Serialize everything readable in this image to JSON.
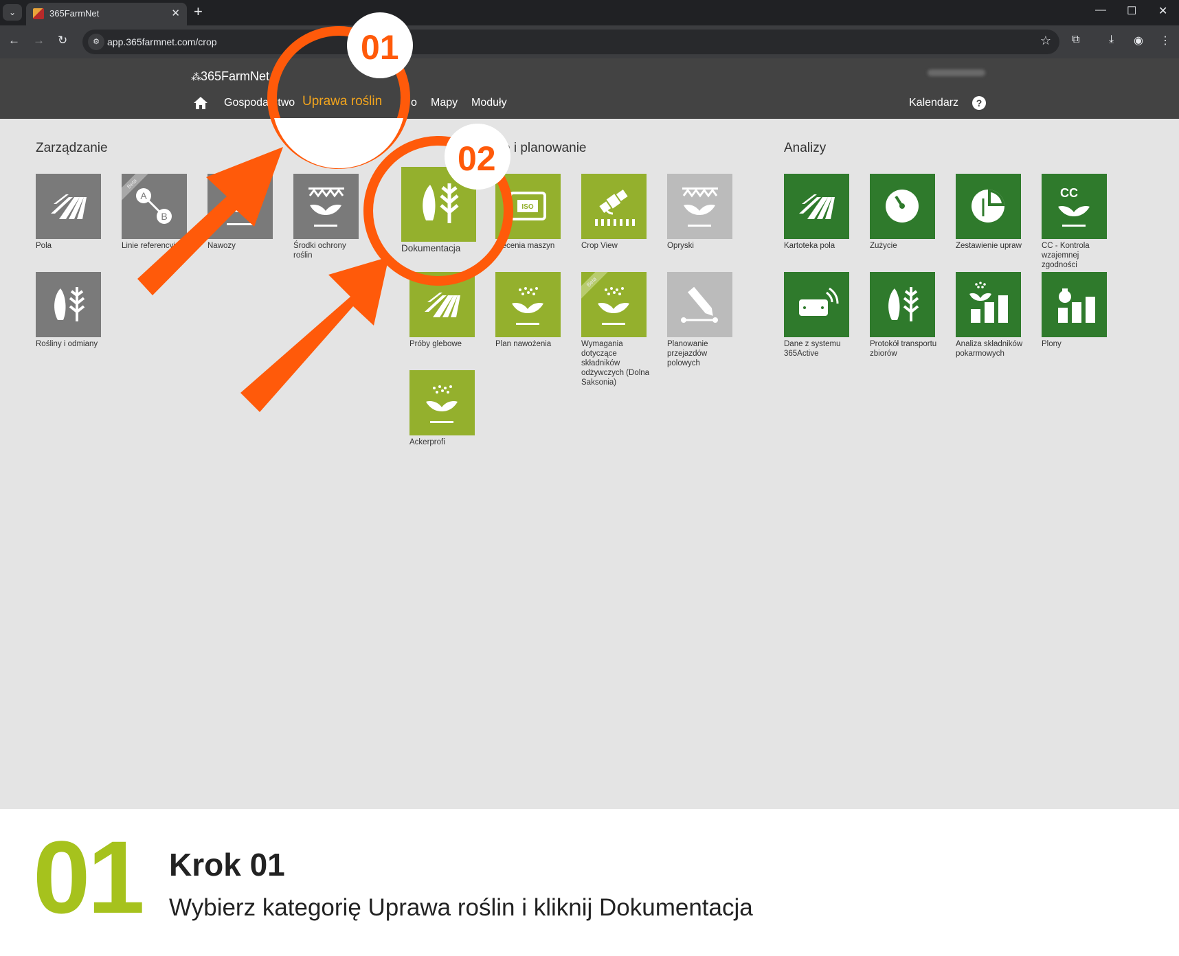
{
  "browser": {
    "tab_title": "365FarmNet",
    "url": "app.365farmnet.com/crop"
  },
  "header": {
    "logo_text": "365FarmNet",
    "menu": {
      "gospodarstwo": "Gospodarstwo",
      "uprawa": "Uprawa roślin",
      "trzeci": "o",
      "mapy": "Mapy",
      "moduly": "Moduły"
    },
    "calendar": "Kalendarz",
    "help": "?"
  },
  "sections": {
    "zarzadzanie": "Zarządzanie",
    "planowanie": "e i planowanie",
    "analizy": "Analizy"
  },
  "tiles": {
    "pola": "Pola",
    "linie": "Linie referencyjne",
    "nawozy": "Nawozy",
    "srodki": "Środki ochrony roślin",
    "rosliny": "Rośliny i odmiany",
    "dokumentacja": "Dokumentacja",
    "zlecenia": "Zlecenia maszyn",
    "crop_view": "Crop View",
    "opryski": "Opryski",
    "proby": "Próby glebowe",
    "plan": "Plan nawożenia",
    "wymagania": "Wymagania dotyczące składników odżywczych (Dolna Saksonia)",
    "planowanie": "Planowanie przejazdów polowych",
    "ackerprofi": "Ackerprofi",
    "kartoteka": "Kartoteka pola",
    "zuzycie": "Zużycie",
    "zestawienie": "Zestawienie upraw",
    "cc": "CC - Kontrola wzajemnej zgodności",
    "dane": "Dane z systemu 365Active",
    "protokol": "Protokół transportu zbiorów",
    "analiza": "Analiza składników pokarmowych",
    "plony": "Plony",
    "beta": "Beta",
    "iso": "ISO",
    "cc_mark": "CC",
    "ab_a": "A",
    "ab_b": "B"
  },
  "callouts": {
    "one": "01",
    "two": "02"
  },
  "footer": {
    "step_number": "01",
    "step_title": "Krok 01",
    "step_description": "Wybierz kategorię Uprawa roślin i kliknij Dokumentacja"
  },
  "colors": {
    "accent_orange": "#ff5a0a",
    "active_menu": "#f3a51d",
    "lime_tile": "#94b02d",
    "dark_green_tile": "#2f7a2c",
    "step_number": "#a6c21d"
  },
  "icons": [
    "field-icon",
    "ab-line-icon",
    "plant-icon",
    "sprayer-plant-icon",
    "crop-icon",
    "iso-icon",
    "satellite-icon",
    "pen-icon",
    "gauge-icon",
    "pie-icon",
    "tractor-signal-icon",
    "bar-plant-icon",
    "money-bar-icon",
    "home-icon",
    "help-icon"
  ]
}
